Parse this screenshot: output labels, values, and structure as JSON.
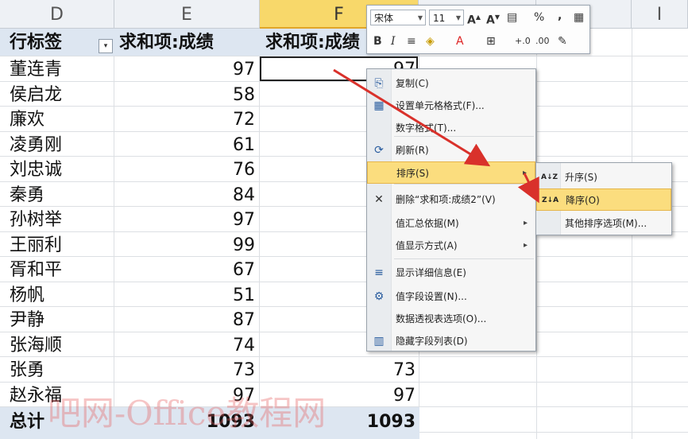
{
  "columns": {
    "d": "D",
    "e": "E",
    "f": "F",
    "i": "I"
  },
  "header": {
    "row_label": "行标签",
    "sum1": "求和项:成绩",
    "sum2": "求和项:成绩"
  },
  "rows": [
    {
      "name": "董连青",
      "v1": "97",
      "v2": "97"
    },
    {
      "name": "侯启龙",
      "v1": "58",
      "v2": ""
    },
    {
      "name": "廉欢",
      "v1": "72",
      "v2": ""
    },
    {
      "name": "凌勇刚",
      "v1": "61",
      "v2": ""
    },
    {
      "name": "刘忠诚",
      "v1": "76",
      "v2": ""
    },
    {
      "name": "秦勇",
      "v1": "84",
      "v2": ""
    },
    {
      "name": "孙树举",
      "v1": "97",
      "v2": ""
    },
    {
      "name": "王丽利",
      "v1": "99",
      "v2": ""
    },
    {
      "name": "胥和平",
      "v1": "67",
      "v2": ""
    },
    {
      "name": "杨帆",
      "v1": "51",
      "v2": ""
    },
    {
      "name": "尹静",
      "v1": "87",
      "v2": ""
    },
    {
      "name": "张海顺",
      "v1": "74",
      "v2": ""
    },
    {
      "name": "张勇",
      "v1": "73",
      "v2": "73"
    },
    {
      "name": "赵永福",
      "v1": "97",
      "v2": "97"
    }
  ],
  "total": {
    "label": "总计",
    "v1": "1093",
    "v2": "1093"
  },
  "mini_toolbar": {
    "font": "宋体",
    "size": "11"
  },
  "context_menu": [
    {
      "label": "复制(C)",
      "icon": "copy-icon"
    },
    {
      "label": "设置单元格格式(F)...",
      "icon": "format-cells-icon"
    },
    {
      "label": "数字格式(T)...",
      "icon": ""
    },
    {
      "label": "刷新(R)",
      "icon": "refresh-icon"
    },
    {
      "label": "排序(S)",
      "icon": "",
      "submenu": true
    },
    {
      "label": "删除“求和项:成绩2”(V)",
      "icon": "delete-icon"
    },
    {
      "label": "值汇总依据(M)",
      "icon": "",
      "submenu": true
    },
    {
      "label": "值显示方式(A)",
      "icon": "",
      "submenu": true
    },
    {
      "label": "显示详细信息(E)",
      "icon": "details-icon"
    },
    {
      "label": "值字段设置(N)...",
      "icon": "field-settings-icon"
    },
    {
      "label": "数据透视表选项(O)...",
      "icon": ""
    },
    {
      "label": "隐藏字段列表(D)",
      "icon": "field-list-icon"
    }
  ],
  "sort_submenu": [
    {
      "label": "升序(S)",
      "icon": "sort-ascending-icon"
    },
    {
      "label": "降序(O)",
      "icon": "sort-descending-icon"
    },
    {
      "label": "其他排序选项(M)...",
      "icon": ""
    }
  ],
  "watermark": "吧网-Office教程网",
  "colors": {
    "header_band": "#dde6f1",
    "highlight": "#fbdd7e",
    "arrow": "#d9312b"
  }
}
